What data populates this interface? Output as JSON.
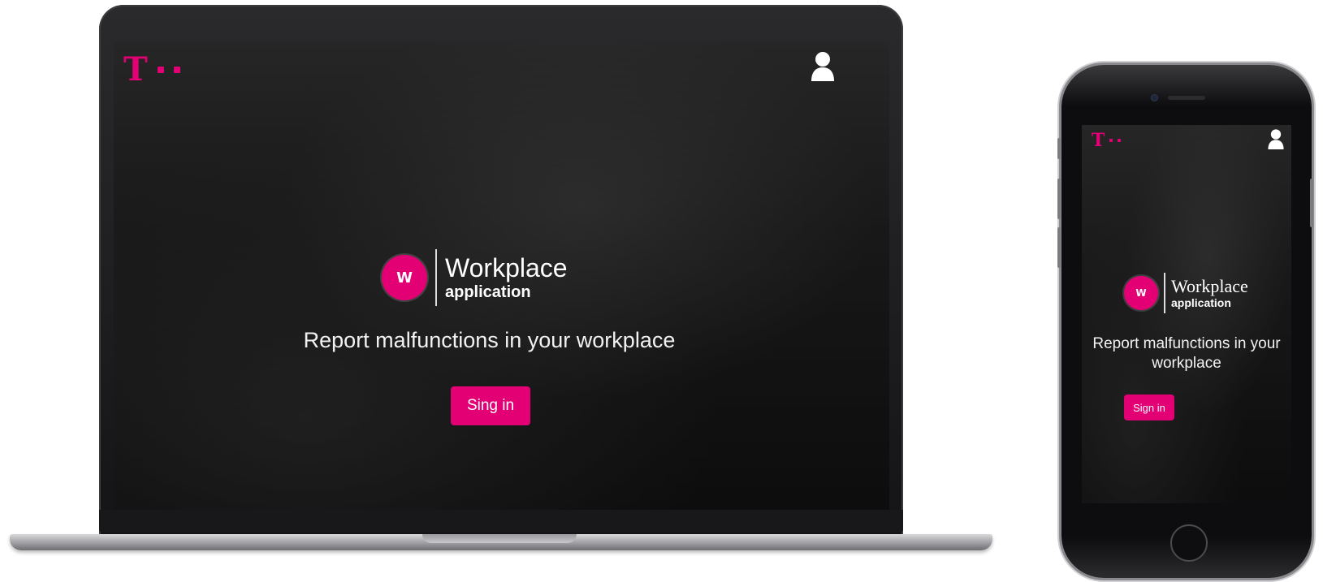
{
  "brand": {
    "accent_color": "#e20074",
    "logo_icon": "telekom-t-logo-icon",
    "user_icon": "user-account-icon",
    "badge_icon": "workplace-app-icon",
    "badge_letters": "W"
  },
  "laptop": {
    "app_name": "Workplace",
    "app_sub": "application",
    "tagline": "Report malfunctions in your workplace",
    "signin_label": "Sing in"
  },
  "phone": {
    "app_name": "Workplace",
    "app_sub": "application",
    "tagline": "Report malfunctions in your workplace",
    "signin_label": "Sign in"
  }
}
